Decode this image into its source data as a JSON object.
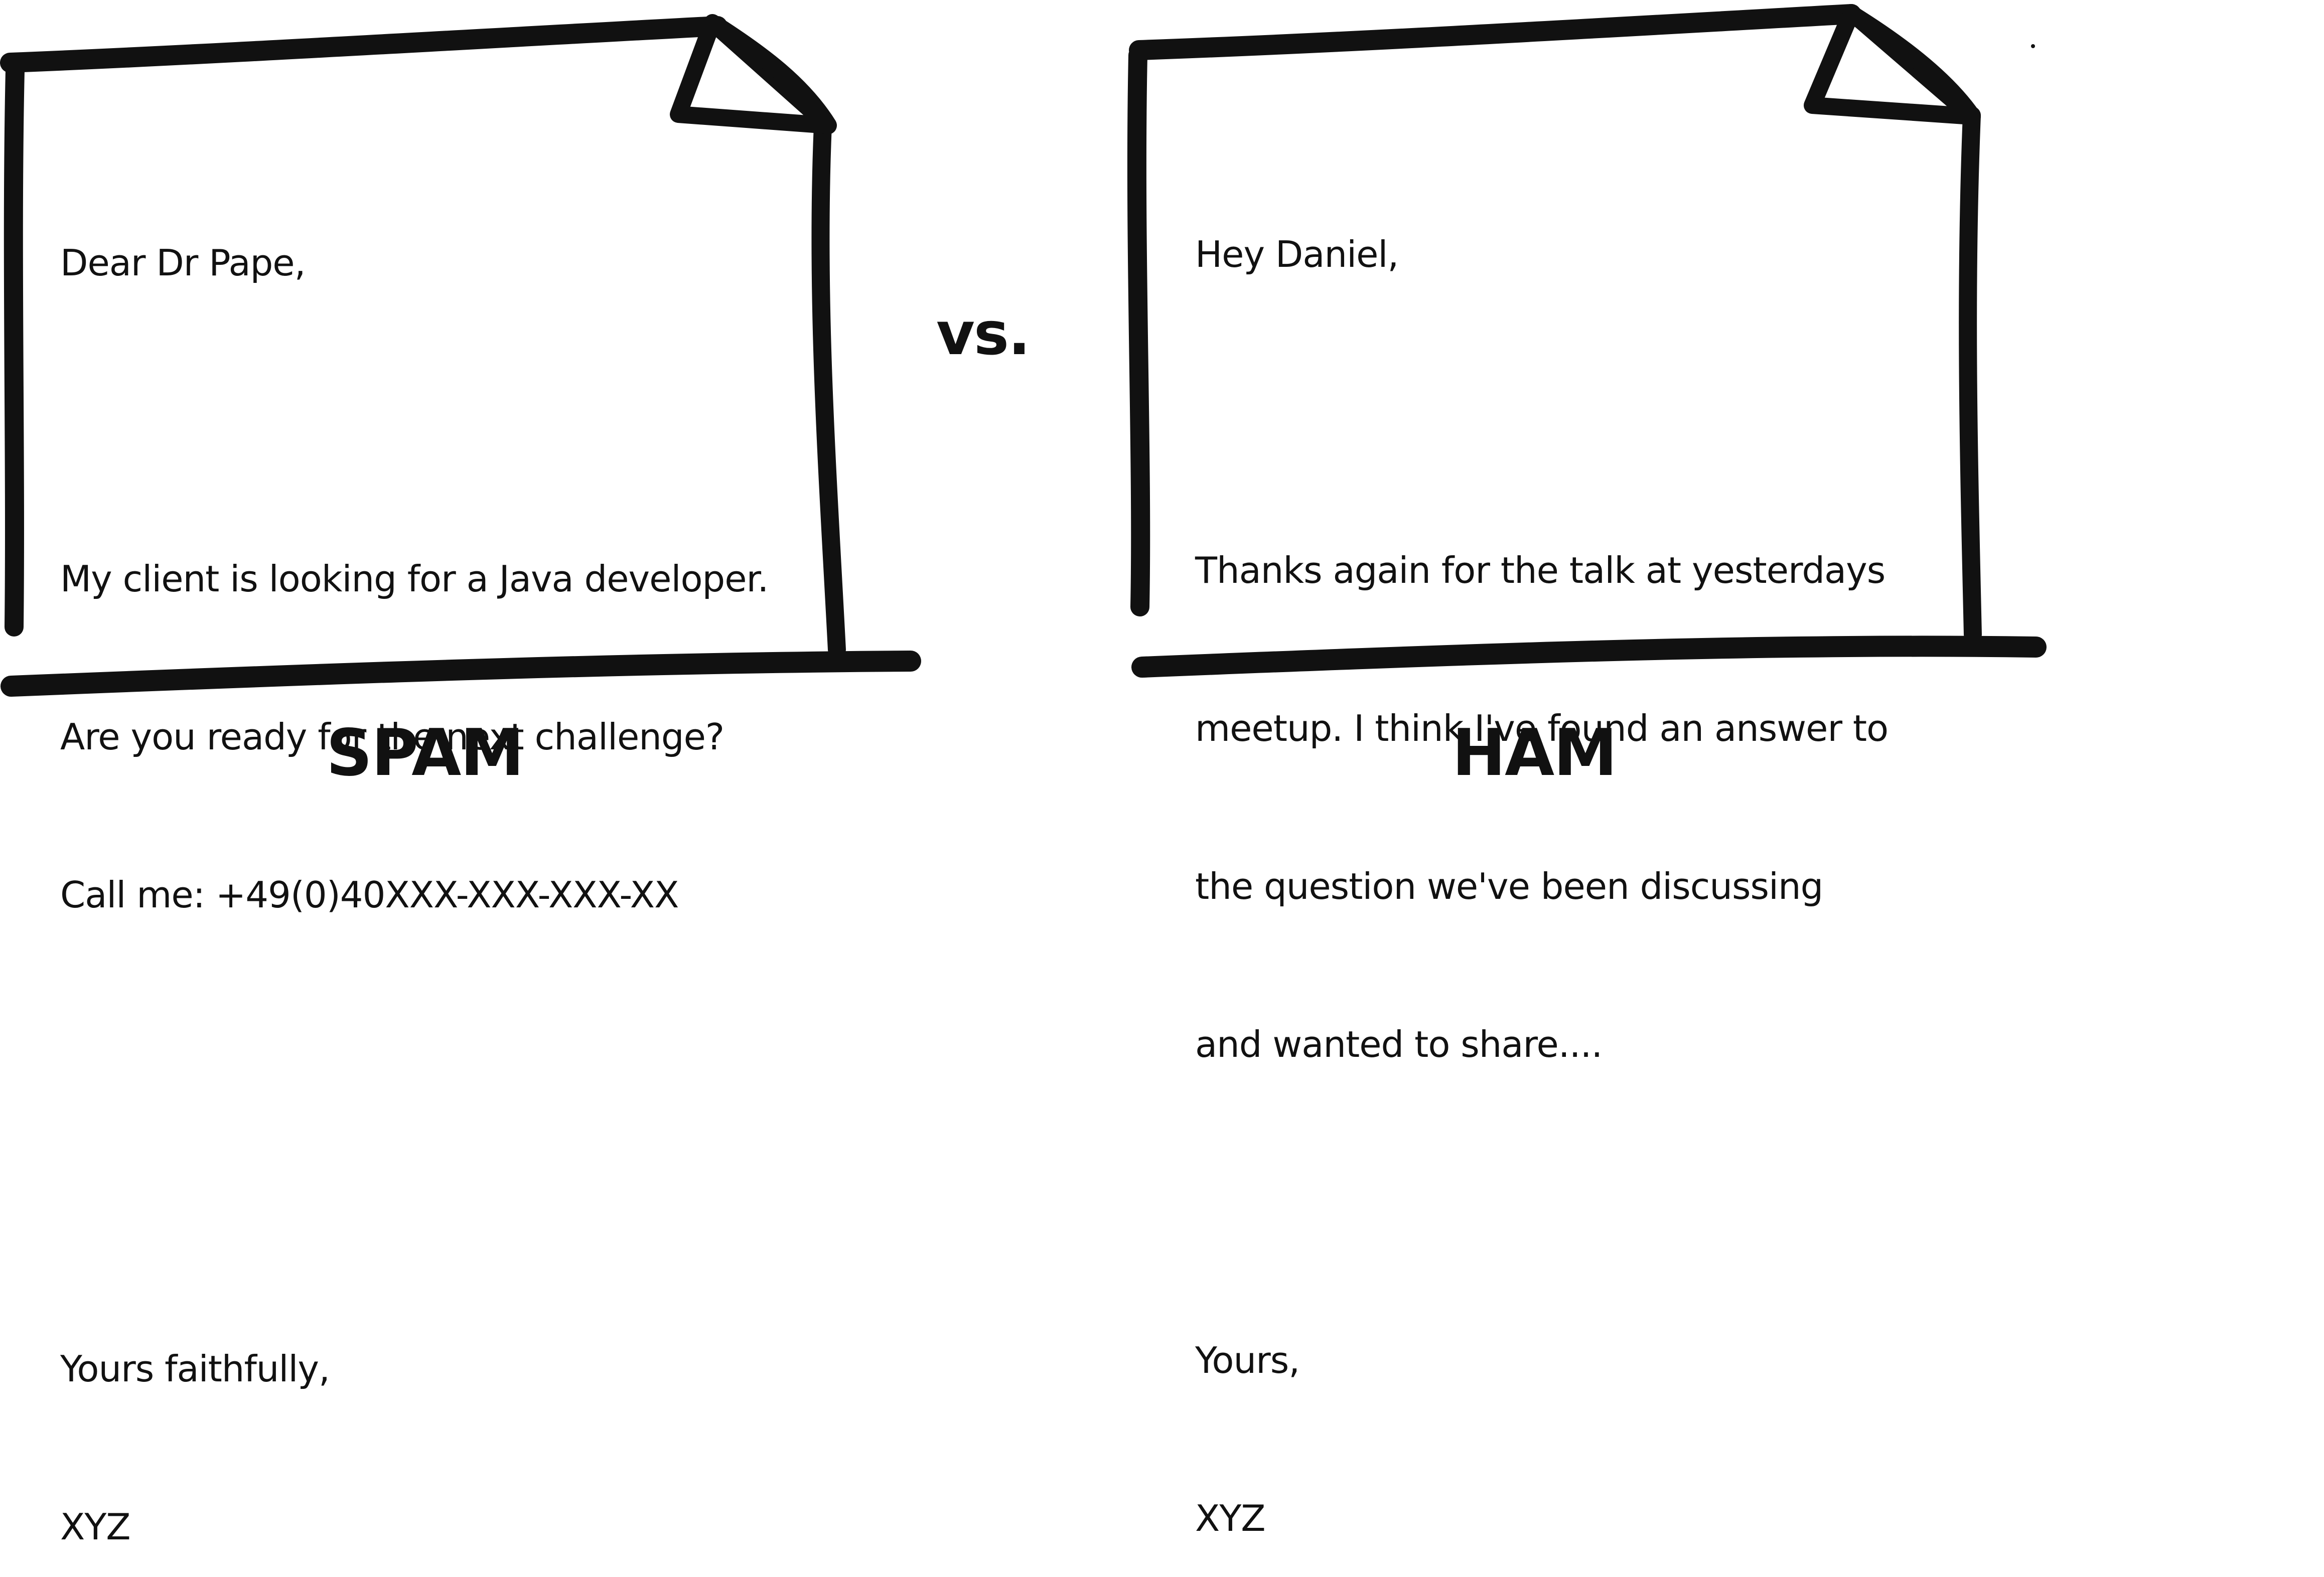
{
  "spam_letter": {
    "lines": [
      "Dear Dr Pape,",
      "",
      "My client is looking for a Java developer.",
      "Are you ready for the next challenge?",
      "Call me: +49(0)40XXX-XXX-XXX-XX",
      "",
      "",
      "Yours faithfully,",
      "XYZ"
    ]
  },
  "ham_letter": {
    "lines": [
      "Hey Daniel,",
      "",
      "Thanks again for the talk at yesterdays",
      "meetup. I think I've found an answer to",
      "the question we've been discussing",
      "and wanted to share....",
      "",
      "Yours,",
      "XYZ"
    ]
  },
  "labels": {
    "spam": "SPAM",
    "vs": "vs.",
    "ham": "HAM"
  },
  "colors": {
    "ink": "#111111",
    "background": "#ffffff"
  }
}
